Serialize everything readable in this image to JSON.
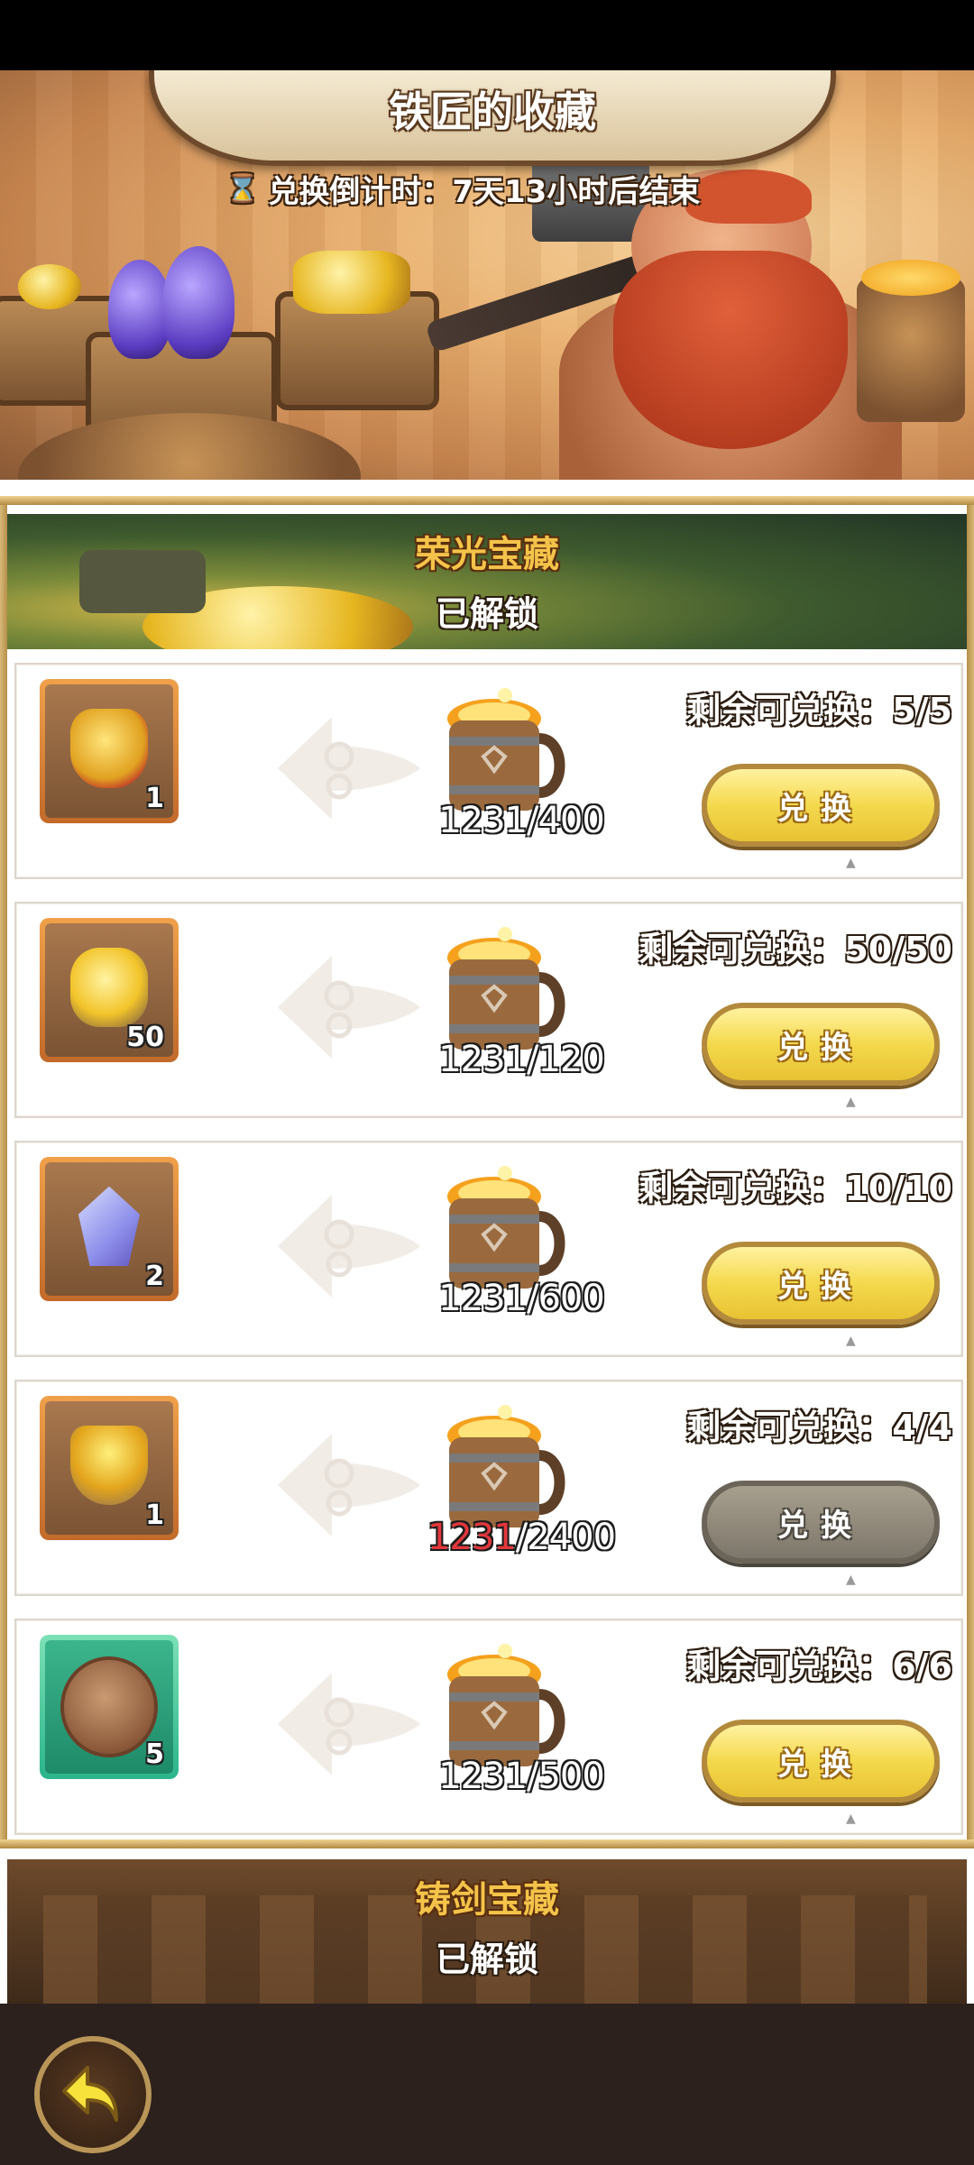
{
  "header": {
    "title": "铁匠的收藏",
    "countdown": "兑换倒计时：7天13小时后结束"
  },
  "sections": [
    {
      "title": "荣光宝藏",
      "status": "已解锁"
    },
    {
      "title": "铸剑宝藏",
      "status": "已解锁"
    }
  ],
  "rows": [
    {
      "item_icon": "gold-badge-icon",
      "count": "1",
      "have": "1231",
      "cost": "/400",
      "remaining": "剩余可兑换：5/5",
      "button": "兑换",
      "enabled": true
    },
    {
      "item_icon": "gold-ore-icon",
      "count": "50",
      "have": "1231",
      "cost": "/120",
      "remaining": "剩余可兑换：50/50",
      "button": "兑换",
      "enabled": true
    },
    {
      "item_icon": "crystal-icon",
      "count": "2",
      "have": "1231",
      "cost": "/600",
      "remaining": "剩余可兑换：10/10",
      "button": "兑换",
      "enabled": true
    },
    {
      "item_icon": "gold-bowl-icon",
      "count": "1",
      "have": "1231",
      "cost": "/2400",
      "remaining": "剩余可兑换：4/4",
      "button": "兑换",
      "enabled": false
    },
    {
      "item_icon": "dragon-coin-icon",
      "count": "5",
      "have": "1231",
      "cost": "/500",
      "remaining": "剩余可兑换：6/6",
      "button": "兑换",
      "enabled": true
    }
  ],
  "colors": {
    "button_enabled": "#f4d94d",
    "button_disabled": "#8a8374",
    "insufficient": "#e2373c"
  }
}
